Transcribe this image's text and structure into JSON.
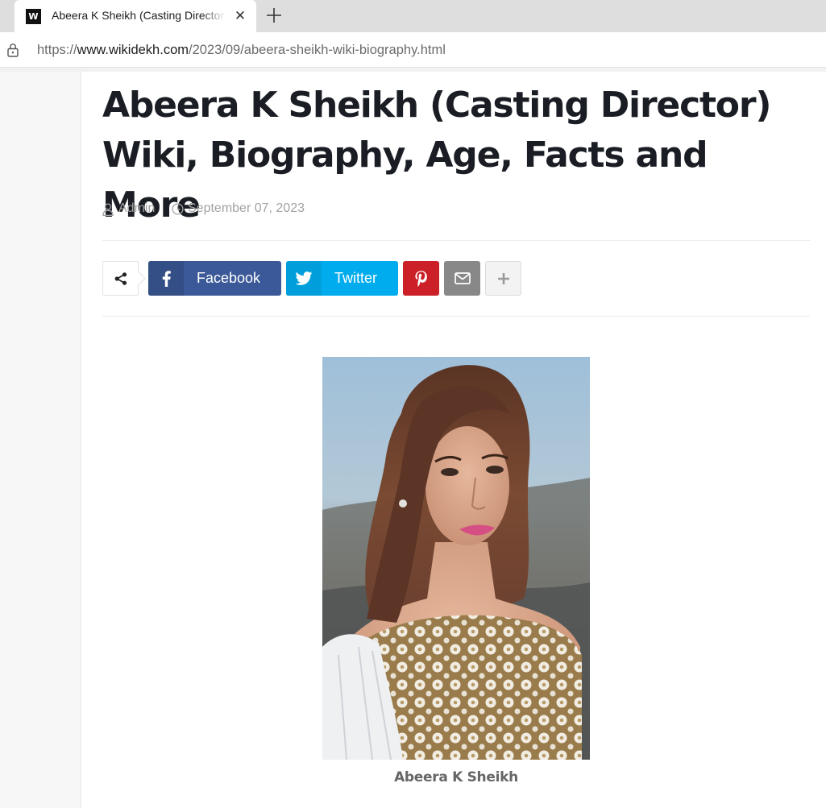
{
  "browser": {
    "tab": {
      "favicon_letter": "W",
      "title": "Abeera K Sheikh (Casting Director) Wiki, Biography, Age, Facts and More",
      "close_glyph": "✕"
    },
    "address": {
      "scheme": "https://",
      "host": "www.wikidekh.com",
      "path": "/2023/09/abeera-sheikh-wiki-biography.html"
    }
  },
  "article": {
    "title": "Abeera K Sheikh (Casting Director) Wiki, Biography, Age, Facts and More",
    "author": "Admin",
    "date": "September 07, 2023"
  },
  "share": {
    "facebook_label": "Facebook",
    "twitter_label": "Twitter",
    "icons": [
      "share-icon",
      "facebook-icon",
      "twitter-icon",
      "pinterest-icon",
      "email-icon",
      "plus-icon"
    ],
    "colors": {
      "facebook": "#3b5998",
      "twitter": "#00aced",
      "pinterest": "#cb2027",
      "email": "#888888"
    }
  },
  "figure": {
    "caption": "Abeera K Sheikh"
  }
}
